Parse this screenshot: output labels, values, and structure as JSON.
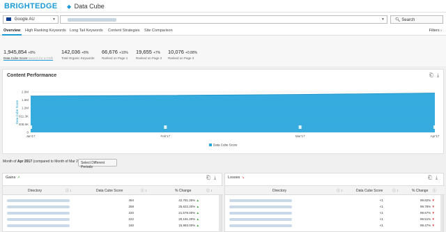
{
  "header": {
    "logo": "BRIGHTEDGE",
    "app_title": "Data Cube"
  },
  "search": {
    "location": "Google AU",
    "search_label": "Search"
  },
  "tabs": [
    {
      "label": "Overview",
      "active": true
    },
    {
      "label": "High Ranking Keywords"
    },
    {
      "label": "Long Tail Keywords"
    },
    {
      "label": "Content Strategies"
    },
    {
      "label": "Site Comparison"
    }
  ],
  "filters_label": "Filters",
  "kpis": [
    {
      "value": "1,945,854",
      "change": "+8%",
      "label": "Data Cube Score",
      "sublabel": "Search for a CSR"
    },
    {
      "value": "142,036",
      "change": "+8%",
      "label": "Total Organic Keywords"
    },
    {
      "value": "66,676",
      "change": "+10%",
      "label": "Ranked on Page 1"
    },
    {
      "value": "19,655",
      "change": "+7%",
      "label": "Ranked on Page 2"
    },
    {
      "value": "10,076",
      "change": "+0.88%",
      "label": "Ranked on Page 3"
    }
  ],
  "performance": {
    "title": "Content Performance",
    "chart_data": {
      "type": "area",
      "x": [
        "Jan'17",
        "Feb'17",
        "Mar'17",
        "Apr'17"
      ],
      "series": [
        {
          "name": "Data Cube Score",
          "values": [
            1800000,
            1830000,
            1880000,
            1945854
          ]
        }
      ],
      "ylabel": "Data Cube Score",
      "yticks": [
        "2.0M",
        "1.6M",
        "1.2M",
        "811.3K",
        "408.6K",
        "0"
      ],
      "ylim": [
        0,
        2000000
      ],
      "grid": true,
      "legend": "bottom-center",
      "color": "#2aa7dc"
    }
  },
  "period": {
    "prefix": "Month of ",
    "month": "Apr 2017",
    "suffix": " (compared to Month of Mar 2017)",
    "button": "Select Different Periods"
  },
  "gains": {
    "title": "Gains",
    "columns": [
      "Directory",
      "Data Cube Score",
      "% Change"
    ],
    "rows": [
      {
        "score": "494",
        "change": "42,781.25%"
      },
      {
        "score": "258",
        "change": "25,622.20%"
      },
      {
        "score": "220",
        "change": "21,578.00%"
      },
      {
        "score": "222",
        "change": "20,191.20%"
      },
      {
        "score": "160",
        "change": "15,993.00%"
      }
    ]
  },
  "losses": {
    "title": "Losses",
    "columns": [
      "Directory",
      "Data Cube Score",
      "% Change"
    ],
    "rows": [
      {
        "score": "<1",
        "change": "99.82%"
      },
      {
        "score": "<1",
        "change": "99.78%"
      },
      {
        "score": "<1",
        "change": "99.67%"
      },
      {
        "score": "<1",
        "change": "99.51%"
      },
      {
        "score": "<1",
        "change": "99.47%"
      }
    ]
  }
}
